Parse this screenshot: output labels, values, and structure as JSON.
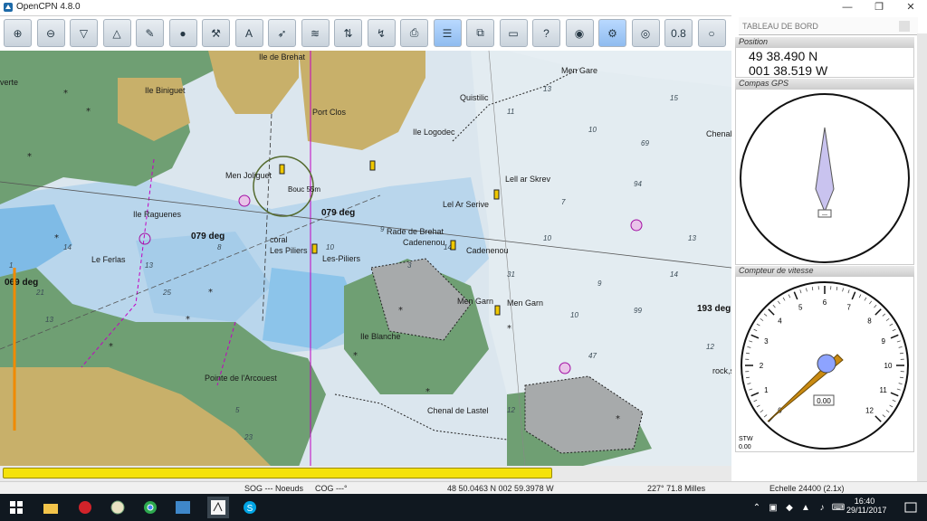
{
  "window": {
    "title": "OpenCPN 4.8.0",
    "minimize": "—",
    "restore": "❐",
    "close": "✕"
  },
  "toolbar": {
    "icons": [
      "zoom-in-icon",
      "zoom-out-icon",
      "scale-down-icon",
      "scale-up-icon",
      "route-icon",
      "mob-icon",
      "tools-icon",
      "aiss-icon",
      "track-icon",
      "ais-icon",
      "tide-icon",
      "current-icon",
      "print-icon",
      "route-manager-icon",
      "chart-quilt-icon",
      "dashboard-icon",
      "help-icon",
      "grib-icon",
      "settings-icon",
      "layers-icon",
      "overzoom-icon",
      "lifebuoy-icon"
    ],
    "zoom_value": "0.8"
  },
  "chart": {
    "place_labels": [
      "Ile de Brehat",
      "Ile Biniguet",
      "Port Clos",
      "Ile Logodec",
      "Quistilic",
      "Men Joliguet",
      "Ile Raguenes",
      "Le Ferlas",
      "coral",
      "Les Piliers",
      "Les-Piliers",
      "Rade de Brehat",
      "Cadenenou",
      "Cadenenou",
      "Lel Ar Serive",
      "Lell ar Skrev",
      "Men Garn",
      "Men Garn",
      "Ile Blanche",
      "Pointe de l'Arcouest",
      "Chenal de Lastel",
      "Men Gare",
      "rock,s",
      "Chenal",
      "verte"
    ],
    "bearings": [
      "079 deg",
      "079 deg",
      "069 deg",
      "193 deg"
    ],
    "ring_label": "Bouc 55m"
  },
  "progress": {
    "fraction": 0.74
  },
  "status": {
    "sog": "SOG --- Noeuds",
    "cog": "COG ---°",
    "position": "48 50.0463 N   002 59.3978 W",
    "bearing_distance": "227°  71.8 Milles",
    "scale": "Echelle 24400 (2.1x)"
  },
  "dashboard": {
    "title": "TABLEAU DE BORD",
    "position_label": "Position",
    "lat": "49 38.490 N",
    "lon": "001 38.519 W",
    "compass_label": "Compas GPS",
    "compass_value": "---",
    "speed_label": "Compteur de vitesse",
    "speed_value": "0.00",
    "stw_label": "STW",
    "stw_value": "0.00",
    "speed_ticks": [
      "0",
      "1",
      "2",
      "3",
      "4",
      "5",
      "6",
      "7",
      "8",
      "9",
      "10",
      "11",
      "12"
    ]
  },
  "taskbar": {
    "time": "16:40",
    "date": "29/11/2017",
    "tray_icons": [
      "chevron-up-icon",
      "network-icon",
      "dropbox-icon",
      "app-icon",
      "volume-icon",
      "keyboard-icon",
      "notification-icon"
    ]
  },
  "colors": {
    "land": "#c8b06a",
    "land_green": "#6a9e72",
    "deep_water": "#dce6ee",
    "shallow_water": "#8bc2ea",
    "progress": "#f5e20b"
  }
}
